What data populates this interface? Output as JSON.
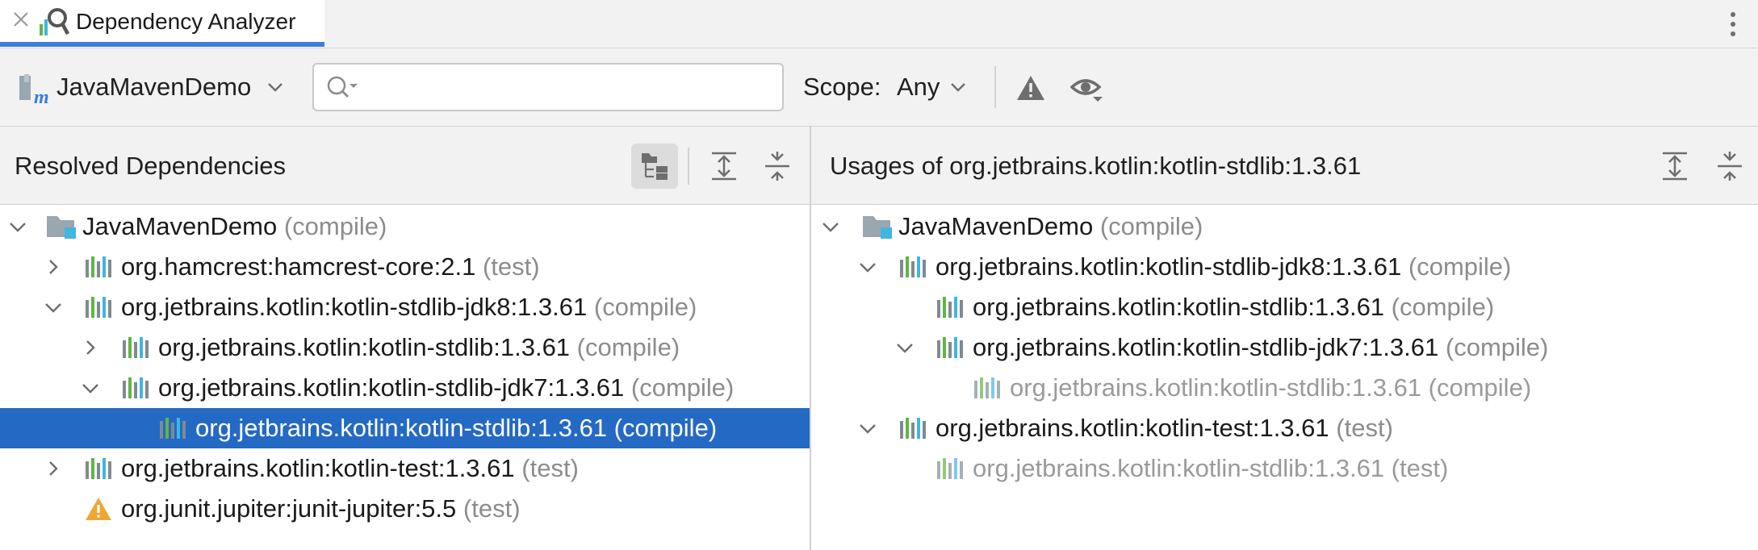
{
  "tab": {
    "title": "Dependency Analyzer"
  },
  "toolbar": {
    "project_name": "JavaMavenDemo",
    "search": {
      "value": "",
      "placeholder": ""
    },
    "scope_label": "Scope:",
    "scope_value": "Any"
  },
  "left_pane": {
    "title": "Resolved Dependencies",
    "rows": [
      {
        "name": "JavaMavenDemo",
        "scope": "(compile)"
      },
      {
        "name": "org.hamcrest:hamcrest-core:2.1",
        "scope": "(test)"
      },
      {
        "name": "org.jetbrains.kotlin:kotlin-stdlib-jdk8:1.3.61",
        "scope": "(compile)"
      },
      {
        "name": "org.jetbrains.kotlin:kotlin-stdlib:1.3.61",
        "scope": "(compile)"
      },
      {
        "name": "org.jetbrains.kotlin:kotlin-stdlib-jdk7:1.3.61",
        "scope": "(compile)"
      },
      {
        "name": "org.jetbrains.kotlin:kotlin-stdlib:1.3.61",
        "scope": "(compile)"
      },
      {
        "name": "org.jetbrains.kotlin:kotlin-test:1.3.61",
        "scope": "(test)"
      },
      {
        "name": "org.junit.jupiter:junit-jupiter:5.5",
        "scope": "(test)"
      }
    ]
  },
  "right_pane": {
    "title": "Usages of org.jetbrains.kotlin:kotlin-stdlib:1.3.61",
    "rows": [
      {
        "name": "JavaMavenDemo",
        "scope": "(compile)"
      },
      {
        "name": "org.jetbrains.kotlin:kotlin-stdlib-jdk8:1.3.61",
        "scope": "(compile)"
      },
      {
        "name": "org.jetbrains.kotlin:kotlin-stdlib:1.3.61",
        "scope": "(compile)"
      },
      {
        "name": "org.jetbrains.kotlin:kotlin-stdlib-jdk7:1.3.61",
        "scope": "(compile)"
      },
      {
        "name": "org.jetbrains.kotlin:kotlin-stdlib:1.3.61",
        "scope": "(compile)"
      },
      {
        "name": "org.jetbrains.kotlin:kotlin-test:1.3.61",
        "scope": "(test)"
      },
      {
        "name": "org.jetbrains.kotlin:kotlin-stdlib:1.3.61",
        "scope": "(test)"
      }
    ]
  },
  "colors": {
    "accent": "#3d7ddc",
    "selection": "#2469c4",
    "warning": "#f0a732",
    "scope_text": "#8c8c8c"
  },
  "icons": [
    "close-icon",
    "dependency-analyzer-icon",
    "more-icon",
    "maven-project-icon",
    "chevron-down-icon",
    "search-icon",
    "warning-icon",
    "eye-icon",
    "group-by-icon",
    "expand-all-icon",
    "collapse-all-icon",
    "folder-module-icon",
    "library-icon"
  ]
}
